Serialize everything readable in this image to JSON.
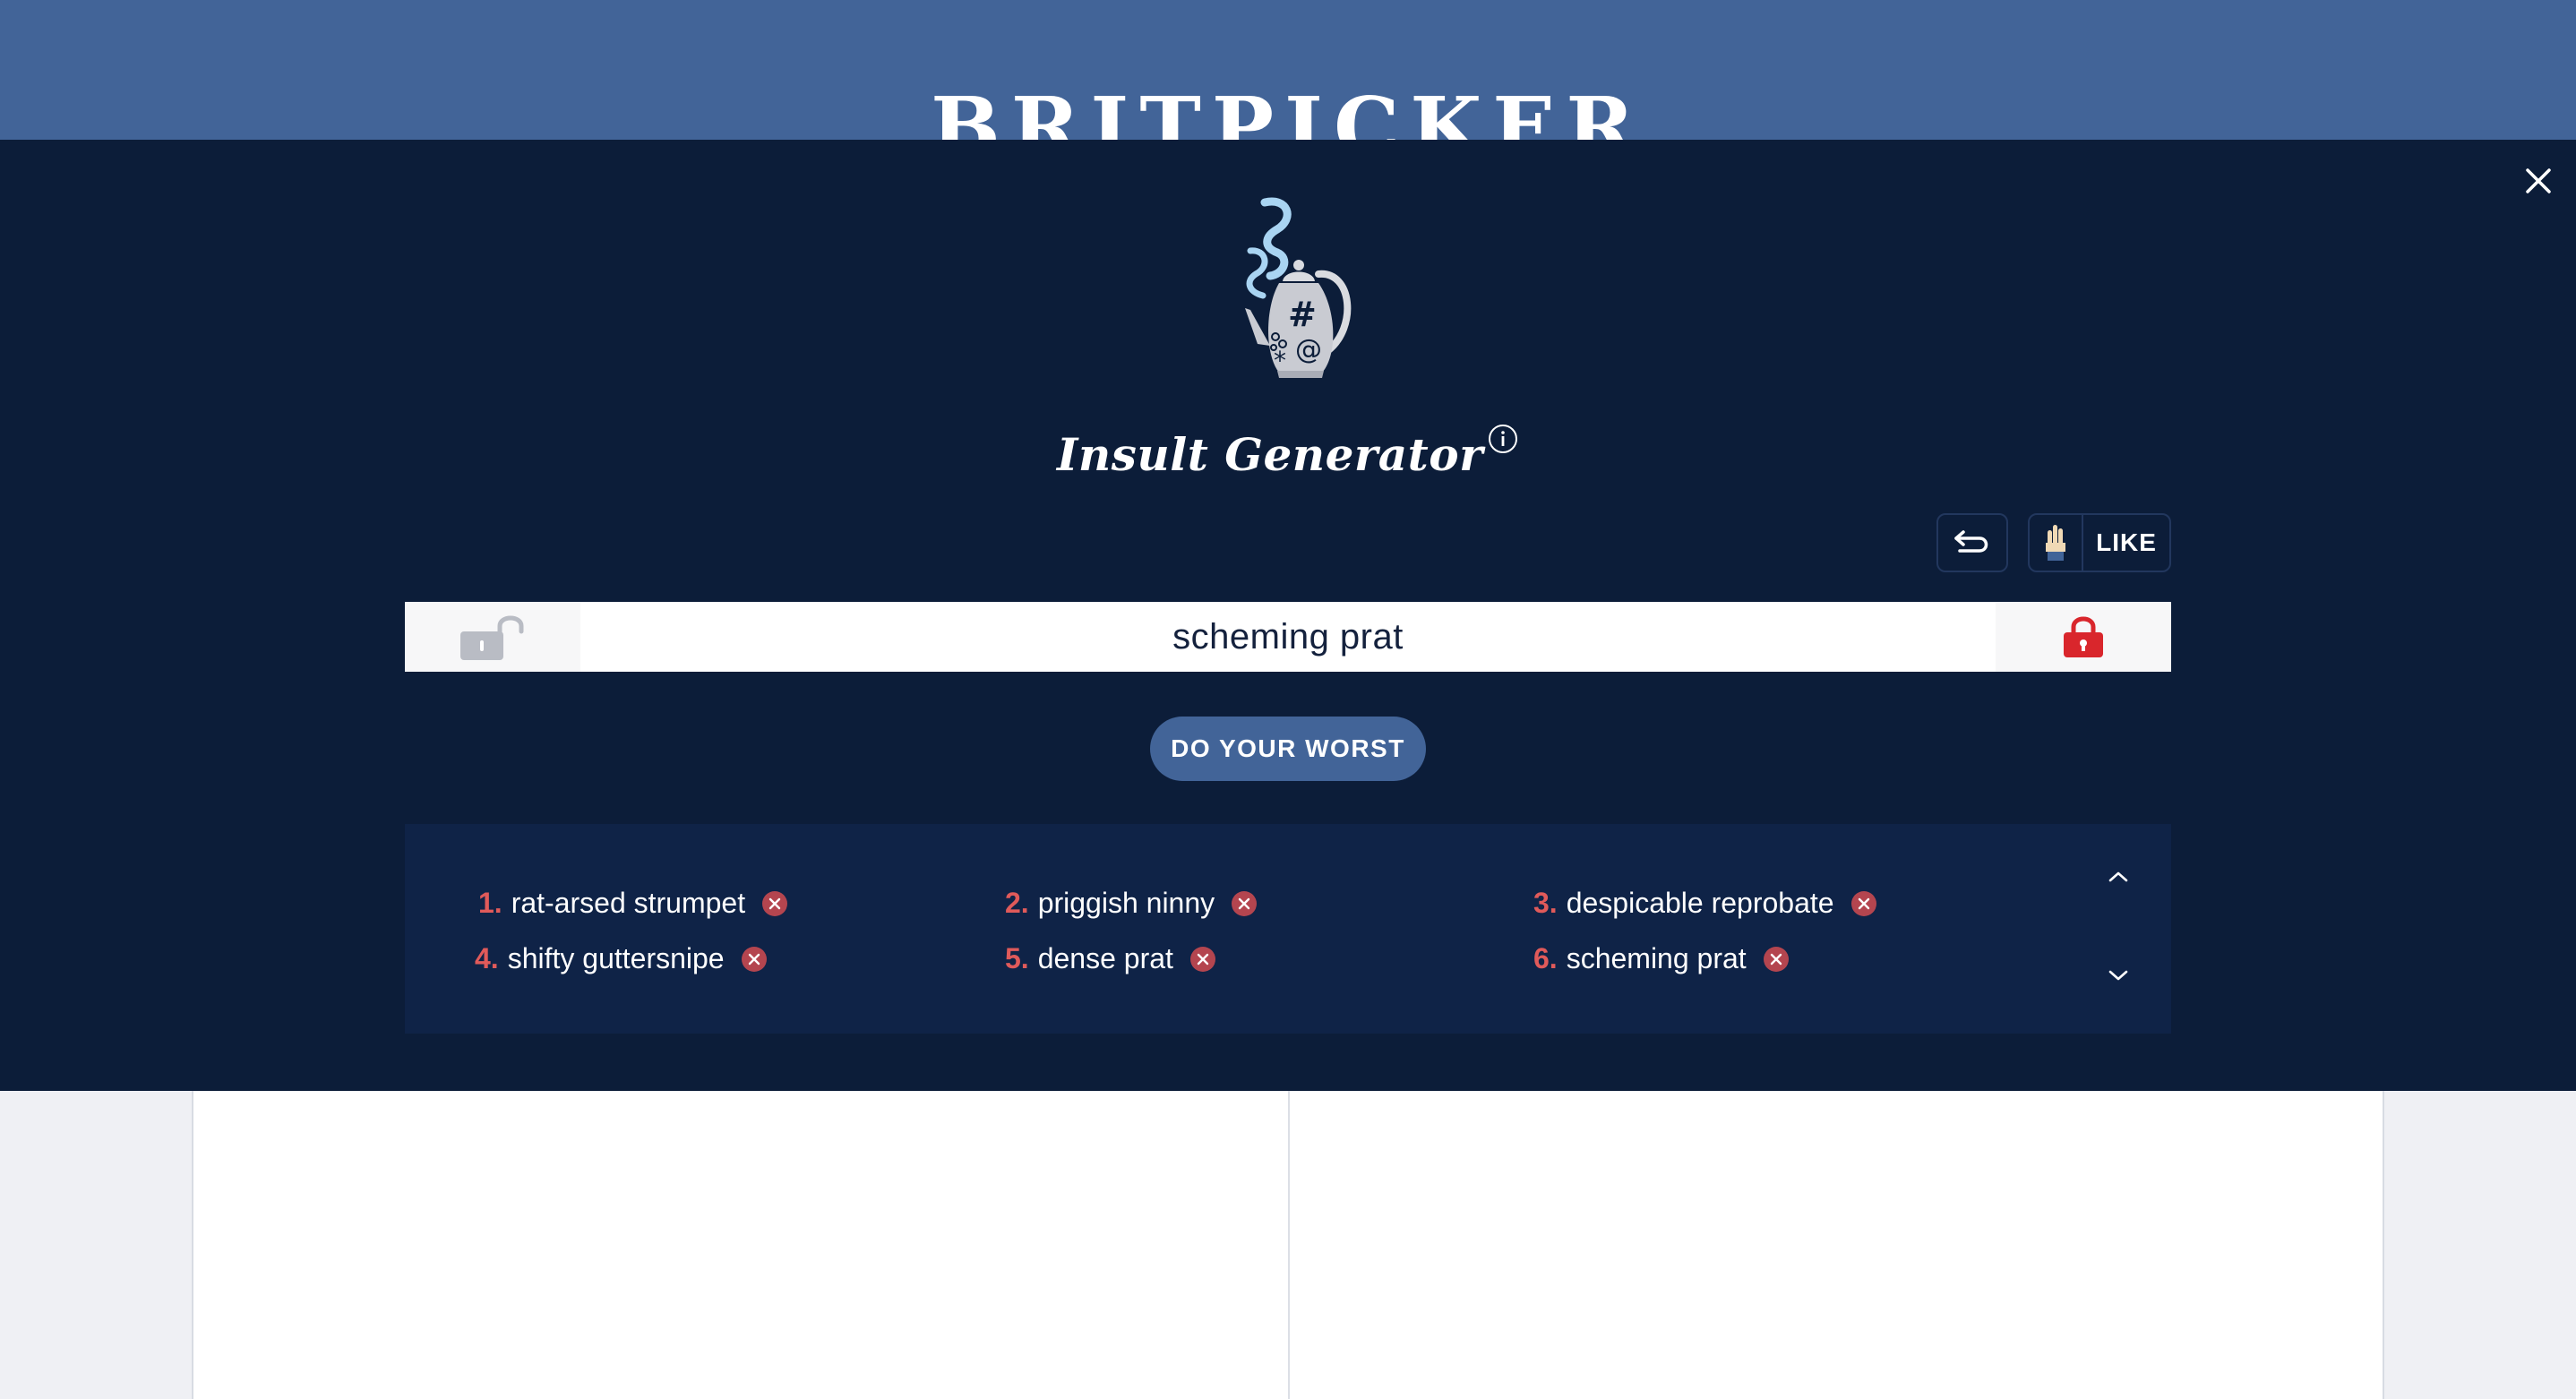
{
  "site": {
    "logo": "BRITPICKER"
  },
  "modal": {
    "title": "Insult Generator",
    "like_label": "LIKE",
    "current_insult": "scheming prat",
    "generate_label": "DO YOUR WORST",
    "history": [
      {
        "num": "1.",
        "text": "rat-arsed strumpet"
      },
      {
        "num": "2.",
        "text": "priggish ninny"
      },
      {
        "num": "3.",
        "text": "despicable reprobate"
      },
      {
        "num": "4.",
        "text": "shifty guttersnipe"
      },
      {
        "num": "5.",
        "text": "dense prat"
      },
      {
        "num": "6.",
        "text": "scheming prat"
      }
    ]
  },
  "icons": {
    "close": "close-icon",
    "teapot": "teapot-logo",
    "info": "info-icon",
    "undo": "undo-icon",
    "like": "hand-icon",
    "left_lock": "unlocked-padlock-icon",
    "right_lock": "locked-padlock-icon",
    "delete": "remove-x-icon",
    "up": "chevron-up-icon",
    "down": "chevron-down-icon"
  },
  "colors": {
    "header_bg": "#426498",
    "modal_bg": "#0c1d39",
    "history_bg": "#0f2347",
    "button_bg": "#426498",
    "accent_red": "#e05a5a",
    "lock_red": "#d9262c"
  }
}
